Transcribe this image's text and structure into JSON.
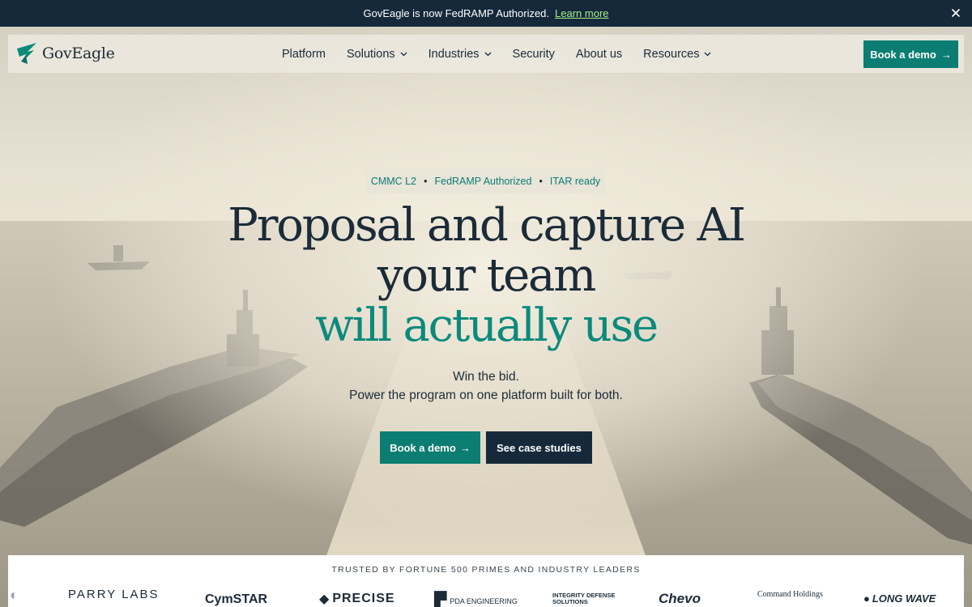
{
  "announcement": {
    "message": "GovEagle is now FedRAMP Authorized.",
    "link": "Learn more"
  },
  "nav": {
    "brand": "GovEagle",
    "items": [
      {
        "label": "Platform",
        "dropdown": false
      },
      {
        "label": "Solutions",
        "dropdown": true
      },
      {
        "label": "Industries",
        "dropdown": true
      },
      {
        "label": "Security",
        "dropdown": false
      },
      {
        "label": "About us",
        "dropdown": false
      },
      {
        "label": "Resources",
        "dropdown": true
      }
    ],
    "cta": "Book a demo"
  },
  "hero": {
    "badges": [
      "CMMC L2",
      "FedRAMP Authorized",
      "ITAR ready"
    ],
    "headline_line1": "Proposal and capture AI",
    "headline_line2": "your team",
    "headline_accent": "will actually use",
    "sub_line1": "Win the bid.",
    "sub_line2": "Power the program on one platform built for both.",
    "primary_button": "Book a demo",
    "secondary_button": "See case studies",
    "arrow": "→"
  },
  "trusted": {
    "title": "TRUSTED BY FORTUNE 500 PRIMES AND INDUSTRY LEADERS",
    "logos": [
      "PARRY LABS",
      "CymSTAR",
      "PRECISE",
      "PDA ENGINEERING",
      "INTEGRITY DEFENSE SOLUTIONS",
      "Chevo",
      "Command Holdings",
      "LONG WAVE"
    ]
  },
  "colors": {
    "accent": "#0b7d72",
    "dark": "#15293a",
    "link_green": "#a6f08c"
  }
}
